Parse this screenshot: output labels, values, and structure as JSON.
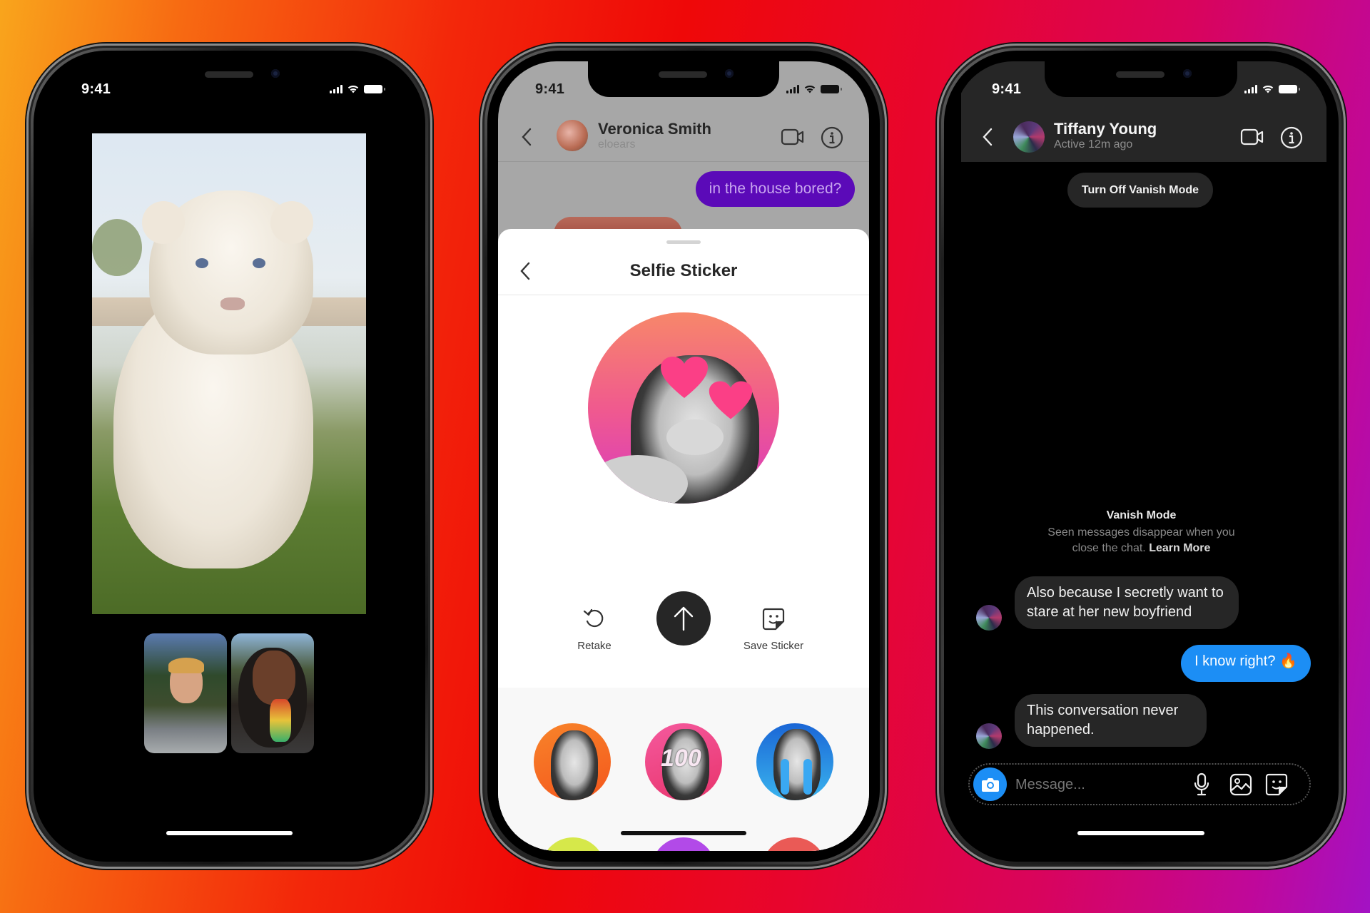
{
  "status_bar": {
    "time": "9:41"
  },
  "phone_video_call": {
    "main_video_subject": "white lion cub",
    "participants": [
      "participant-1",
      "participant-2"
    ]
  },
  "phone_selfie_sticker": {
    "contact": {
      "name": "Veronica Smith",
      "username": "eloears"
    },
    "sent_message": "in the house bored?",
    "sheet_title": "Selfie Sticker",
    "actions": {
      "retake": "Retake",
      "save_sticker": "Save Sticker"
    },
    "sticker_overlays": [
      "hearts",
      "100",
      "tears"
    ],
    "accent_color": "#5b0ab8"
  },
  "phone_vanish_mode": {
    "contact": {
      "name": "Tiffany Young",
      "status": "Active 12m ago"
    },
    "turn_off_label": "Turn Off Vanish Mode",
    "vanish_title": "Vanish Mode",
    "vanish_desc_line1": "Seen messages disappear when you",
    "vanish_desc_line2": "close the chat.",
    "learn_more": "Learn More",
    "messages": [
      {
        "from": "them",
        "text": "Also because I secretly want to stare at her new boyfriend"
      },
      {
        "from": "me",
        "text": "I know right? 🔥"
      },
      {
        "from": "them",
        "text": "This conversation never happened."
      }
    ],
    "composer_placeholder": "Message...",
    "outgoing_color": "#1c8ef5"
  }
}
